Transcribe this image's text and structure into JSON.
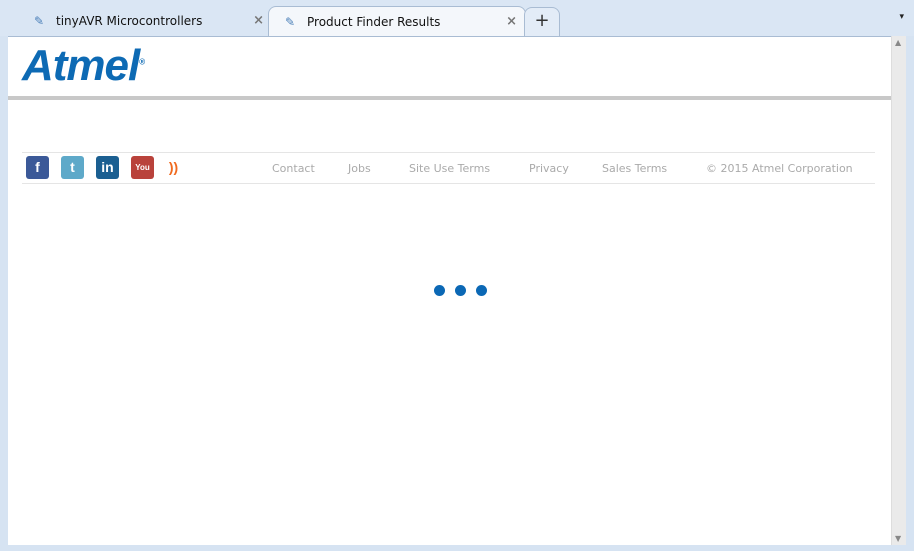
{
  "tabs": [
    {
      "label": "tinyAVR Microcontrollers",
      "active": false
    },
    {
      "label": "Product Finder Results",
      "active": true
    }
  ],
  "new_tab": "+",
  "close": "×",
  "menu": "▾",
  "logo": "Atmel",
  "logo_mark": "®",
  "social": [
    {
      "name": "facebook",
      "glyph": "f",
      "color": "#3b5998"
    },
    {
      "name": "twitter",
      "glyph": "t",
      "color": "#5ea9c9"
    },
    {
      "name": "linkedin",
      "glyph": "in",
      "color": "#1b5f91"
    },
    {
      "name": "youtube",
      "glyph": "You",
      "color": "#b9423b"
    },
    {
      "name": "rss",
      "glyph": "))",
      "color": "#f06a1f"
    }
  ],
  "footer_links": [
    "Contact",
    "Jobs",
    "Site Use Terms",
    "Privacy",
    "Sales Terms"
  ],
  "copyright": "© 2015 Atmel Corporation"
}
